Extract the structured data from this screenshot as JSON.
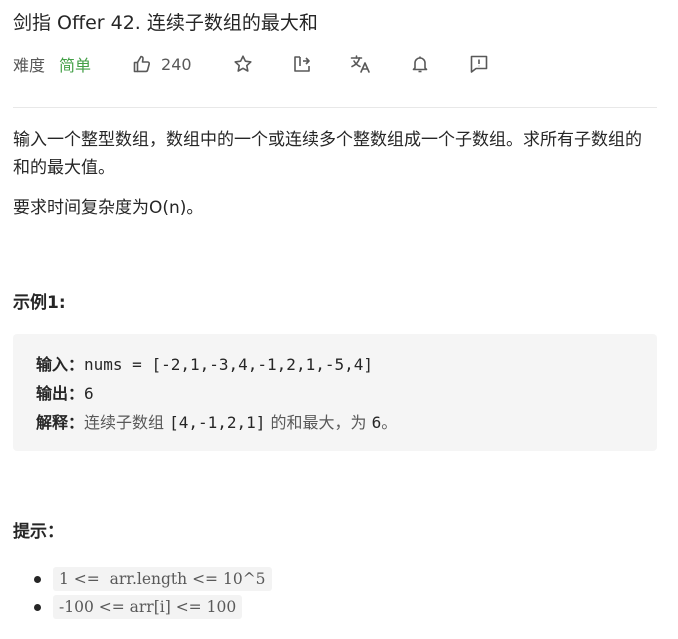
{
  "problem": {
    "title": "剑指 Offer 42. 连续子数组的最大和",
    "difficulty_label": "难度",
    "difficulty": "简单",
    "like_count": "240",
    "difficulty_color": "#43a047"
  },
  "toolbar": {
    "icons": [
      "thumbs-up-icon",
      "star-icon",
      "share-icon",
      "translate-icon",
      "bell-icon",
      "feedback-icon"
    ]
  },
  "description": {
    "paragraph1": "输入一个整型数组，数组中的一个或连续多个整数组成一个子数组。求所有子数组的和的最大值。",
    "paragraph2": "要求时间复杂度为O(n)。"
  },
  "example": {
    "heading": "示例1:",
    "input_label": "输入：",
    "input_value": "nums = [-2,1,-3,4,-1,2,1,-5,4]",
    "output_label": "输出：",
    "output_value": "6",
    "explain_label": "解释：",
    "explain_text1": "连续子数组 ",
    "explain_code1": "[4,-1,2,1]",
    "explain_text2": " 的和最大，为 ",
    "explain_code2": "6",
    "explain_text3": "。"
  },
  "hints": {
    "heading": "提示：",
    "items": [
      "1 <=  arr.length <= 10^5",
      "-100 <= arr[i] <= 100"
    ]
  }
}
